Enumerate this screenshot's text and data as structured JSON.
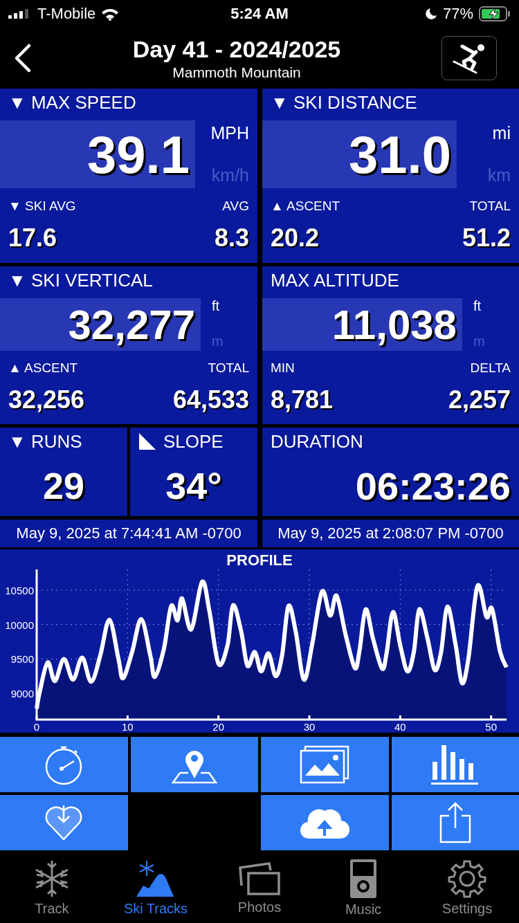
{
  "status_bar": {
    "carrier": "T-Mobile",
    "time": "5:24 AM",
    "battery": "77%"
  },
  "header": {
    "title": "Day 41 - 2024/2025",
    "subtitle": "Mammoth Mountain"
  },
  "panels": [
    {
      "label": "▼ MAX SPEED",
      "value": "39.1",
      "units": [
        {
          "label": "MPH",
          "selected": true
        },
        {
          "label": "km/h",
          "selected": false
        }
      ],
      "stats": [
        {
          "label": "▼ SKI AVG",
          "value": "17.6"
        },
        {
          "label": "AVG",
          "value": "8.3"
        }
      ]
    },
    {
      "label": "▼ SKI DISTANCE",
      "value": "31.0",
      "units": [
        {
          "label": "mi",
          "selected": true
        },
        {
          "label": "km",
          "selected": false
        }
      ],
      "stats": [
        {
          "label": "▲ ASCENT",
          "value": "20.2"
        },
        {
          "label": "TOTAL",
          "value": "51.2"
        }
      ]
    },
    {
      "label": "▼ SKI VERTICAL",
      "value": "32,277",
      "units": [
        {
          "label": "ft",
          "selected": true
        },
        {
          "label": "m",
          "selected": false
        }
      ],
      "stats": [
        {
          "label": "▲ ASCENT",
          "value": "32,256"
        },
        {
          "label": "TOTAL",
          "value": "64,533"
        }
      ]
    },
    {
      "label": "MAX ALTITUDE",
      "value": "11,038",
      "units": [
        {
          "label": "ft",
          "selected": true
        },
        {
          "label": "m",
          "selected": false
        }
      ],
      "stats": [
        {
          "label": "MIN",
          "value": "8,781"
        },
        {
          "label": "DELTA",
          "value": "2,257"
        }
      ]
    }
  ],
  "runs": {
    "label": "▼ RUNS",
    "value": "29"
  },
  "slope": {
    "label": "SLOPE",
    "value": "34°"
  },
  "duration": {
    "label": "DURATION",
    "value": "06:23:26"
  },
  "timestamps": [
    "May 9, 2025 at 7:44:41 AM -0700",
    "May 9, 2025 at 2:08:07 PM -0700"
  ],
  "profile": {
    "chart_data": {
      "type": "area",
      "title": "PROFILE",
      "x": [
        0,
        0.3,
        1.2,
        2,
        3,
        4,
        5,
        6,
        7,
        8,
        9,
        9.5,
        10.5,
        11.5,
        12.5,
        13,
        14,
        14.8,
        15.5,
        16,
        17,
        18.2,
        19,
        20,
        21,
        21.6,
        22.5,
        23.2,
        24,
        24.7,
        25.5,
        26.3,
        27,
        27.7,
        28.5,
        29.4,
        30.3,
        31.4,
        32.3,
        33,
        34,
        35,
        35.5,
        36.2,
        37,
        38,
        38.5,
        39.2,
        40,
        40.8,
        41.5,
        42.1,
        43,
        43.8,
        44.5,
        45.2,
        46.1,
        46.8,
        47.5,
        48.5,
        49.5,
        50.1,
        51,
        51.7
      ],
      "series": [
        {
          "color": "#ffffff",
          "values": [
            8780,
            9000,
            9450,
            9180,
            9500,
            9200,
            9520,
            9170,
            9550,
            10070,
            9500,
            9220,
            9600,
            10080,
            9550,
            9240,
            9650,
            10270,
            10060,
            10380,
            9930,
            10620,
            10200,
            9430,
            9700,
            10280,
            9900,
            9400,
            9600,
            9320,
            9580,
            9250,
            9550,
            10270,
            9900,
            9200,
            9700,
            10480,
            10130,
            10420,
            9850,
            9370,
            9600,
            10220,
            9800,
            9360,
            9580,
            10180,
            9700,
            9320,
            9600,
            10220,
            9800,
            9340,
            9600,
            10260,
            9700,
            9150,
            9500,
            10560,
            10110,
            10230,
            9600,
            9380
          ]
        }
      ],
      "grid": true,
      "xlim": [
        0,
        51.7
      ],
      "ylim": [
        8620,
        10800
      ],
      "xticks": [
        0,
        10,
        20,
        30,
        40,
        50
      ],
      "yticks": [
        9000,
        9500,
        10000,
        10500
      ]
    }
  },
  "actions": [
    {
      "kind": "stopwatch"
    },
    {
      "kind": "map"
    },
    {
      "kind": "photos"
    },
    {
      "kind": "bars"
    },
    {
      "kind": "heart"
    },
    {
      "kind": "empty"
    },
    {
      "kind": "upload"
    },
    {
      "kind": "share"
    }
  ],
  "tabs": [
    {
      "label": "Track",
      "kind": "snowflake",
      "selected": false
    },
    {
      "label": "Ski Tracks",
      "kind": "mountain",
      "selected": true
    },
    {
      "label": "Photos",
      "kind": "photos",
      "selected": false
    },
    {
      "label": "Music",
      "kind": "music",
      "selected": false
    },
    {
      "label": "Settings",
      "kind": "gear",
      "selected": false
    }
  ]
}
